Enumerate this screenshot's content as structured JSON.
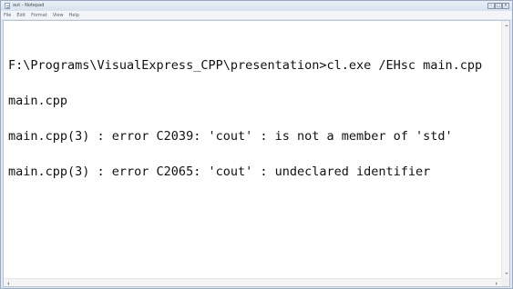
{
  "window": {
    "title": "out - Notepad",
    "controls": {
      "minimize": "–",
      "maximize": "□",
      "close": "×"
    }
  },
  "menubar": {
    "items": [
      {
        "label": "File"
      },
      {
        "label": "Edit"
      },
      {
        "label": "Format"
      },
      {
        "label": "View"
      },
      {
        "label": "Help"
      }
    ]
  },
  "editor": {
    "lines": [
      "",
      "F:\\Programs\\VisualExpress_CPP\\presentation>cl.exe /EHsc main.cpp",
      "main.cpp",
      "main.cpp(3) : error C2039: 'cout' : is not a member of 'std'",
      "main.cpp(3) : error C2065: 'cout' : undeclared identifier"
    ]
  },
  "icons": {
    "app": "notepad-icon",
    "scroll_up": "chevron-up-icon",
    "scroll_down": "chevron-down-icon",
    "scroll_left": "chevron-left-icon",
    "scroll_right": "chevron-right-icon"
  },
  "colors": {
    "titlebar": "#dfe8f3",
    "text": "#111111",
    "background": "#ffffff"
  }
}
